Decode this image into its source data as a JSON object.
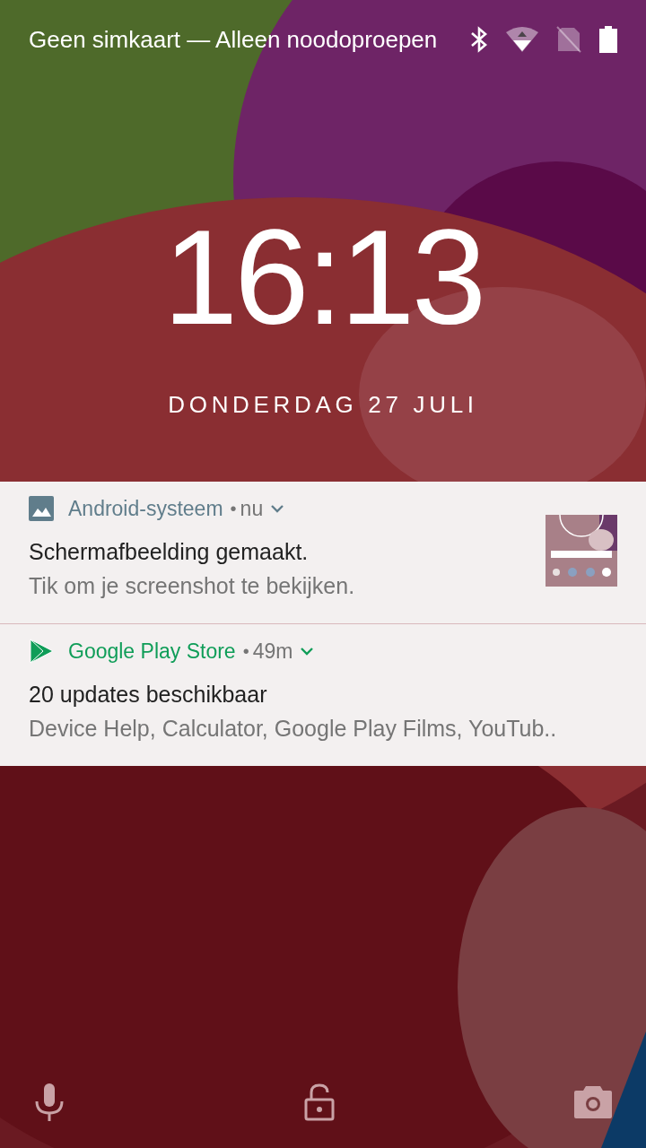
{
  "status_bar": {
    "carrier": "Geen simkaart — Alleen noodoproepen"
  },
  "clock": {
    "time": "16:13",
    "date": "DONDERDAG 27 JULI"
  },
  "notifications": [
    {
      "kind": "screenshot",
      "app": "Android-systeem",
      "color": "#607d8b",
      "separator": "•",
      "time": "nu",
      "title": "Schermafbeelding gemaakt.",
      "text": "Tik om je screenshot te bekijken."
    },
    {
      "kind": "store",
      "app": "Google Play Store",
      "color": "#0f9d58",
      "separator": "•",
      "time": "49m",
      "title": "20 updates beschikbaar",
      "text": "Device Help, Calculator, Google Play Films, YouTub.."
    }
  ]
}
